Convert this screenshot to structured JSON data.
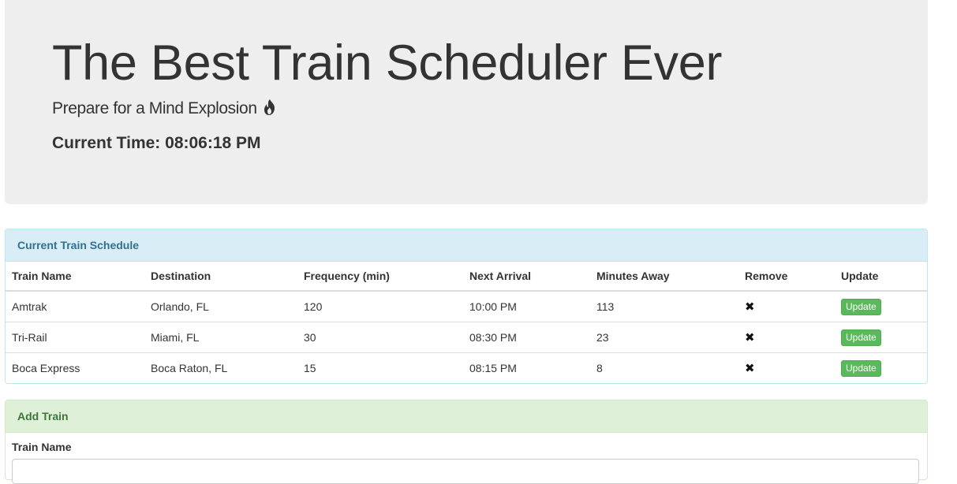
{
  "header": {
    "title": "The Best Train Scheduler Ever",
    "subtitle": "Prepare for a Mind Explosion",
    "fire_icon": "fire-icon",
    "current_time_label": "Current Time: 08:06:18 PM"
  },
  "schedule": {
    "heading": "Current Train Schedule",
    "columns": [
      "Train Name",
      "Destination",
      "Frequency (min)",
      "Next Arrival",
      "Minutes Away",
      "Remove",
      "Update"
    ],
    "rows": [
      {
        "name": "Amtrak",
        "destination": "Orlando, FL",
        "frequency": "120",
        "next_arrival": "10:00 PM",
        "minutes_away": "113",
        "remove_icon": "✖",
        "update_label": "Update"
      },
      {
        "name": "Tri-Rail",
        "destination": "Miami, FL",
        "frequency": "30",
        "next_arrival": "08:30 PM",
        "minutes_away": "23",
        "remove_icon": "✖",
        "update_label": "Update"
      },
      {
        "name": "Boca Express",
        "destination": "Boca Raton, FL",
        "frequency": "15",
        "next_arrival": "08:15 PM",
        "minutes_away": "8",
        "remove_icon": "✖",
        "update_label": "Update"
      }
    ]
  },
  "add_train": {
    "heading": "Add Train",
    "train_name_label": "Train Name",
    "train_name_value": ""
  },
  "colors": {
    "jumbotron_bg": "#eeeeee",
    "info_heading_bg": "#d9edf7",
    "success_heading_bg": "#dff0d8",
    "update_button": "#5cb85c"
  }
}
